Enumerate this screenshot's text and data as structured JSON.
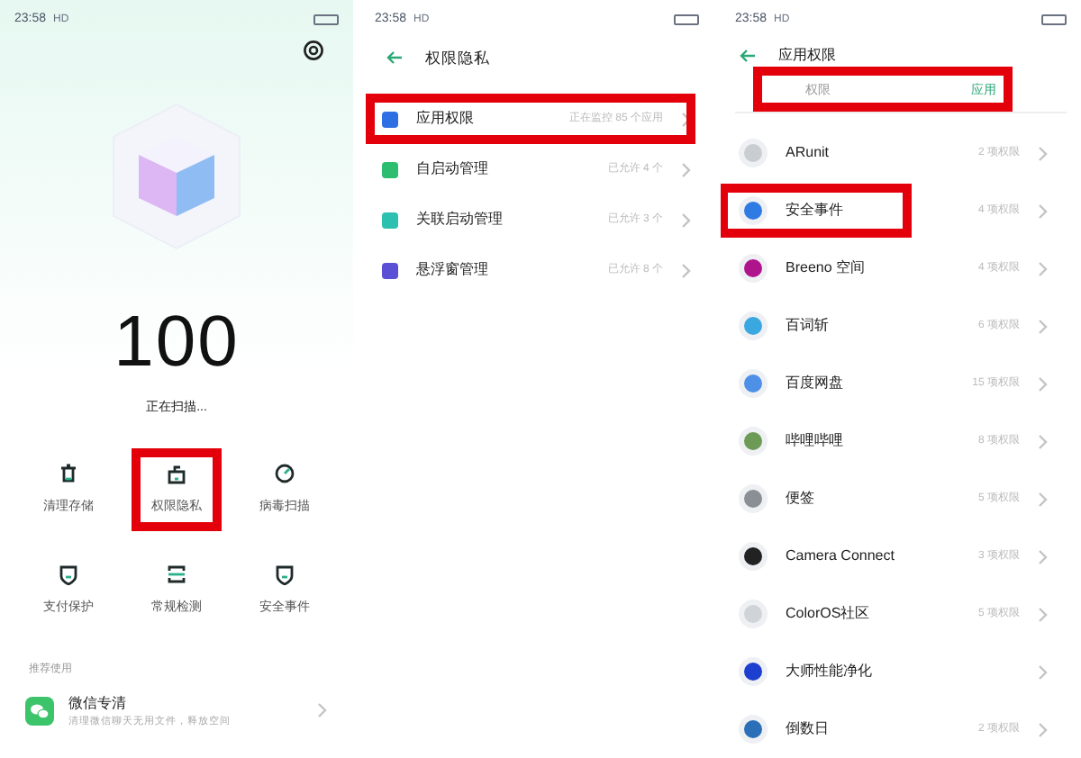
{
  "screens": [
    {
      "status_bar": {
        "time": "23:58",
        "network": "HD"
      },
      "score": "100",
      "scan_status": "正在扫描...",
      "tools": [
        {
          "label": "清理存储",
          "kind": "trash",
          "highlighted": false
        },
        {
          "label": "权限隐私",
          "kind": "lock",
          "highlighted": true
        },
        {
          "label": "病毒扫描",
          "kind": "gauge",
          "highlighted": false
        },
        {
          "label": "支付保护",
          "kind": "shield",
          "highlighted": false
        },
        {
          "label": "常规检测",
          "kind": "scan",
          "highlighted": false
        },
        {
          "label": "安全事件",
          "kind": "shield",
          "highlighted": false
        }
      ],
      "section_title": "推荐使用",
      "recommend": {
        "title": "微信专清",
        "subtitle": "清理微信聊天无用文件，释放空间"
      }
    },
    {
      "status_bar": {
        "time": "23:58",
        "network": "HD"
      },
      "title": "权限隐私",
      "rows": [
        {
          "label": "应用权限",
          "value": "正在监控 85 个应用",
          "color": "#2f6fe4",
          "highlighted": true
        },
        {
          "label": "自启动管理",
          "value": "已允许 4 个",
          "color": "#2dbd6e",
          "highlighted": false
        },
        {
          "label": "关联启动管理",
          "value": "已允许 3 个",
          "color": "#2cc0b0",
          "highlighted": false
        },
        {
          "label": "悬浮窗管理",
          "value": "已允许 8 个",
          "color": "#5b4fd6",
          "highlighted": false
        }
      ]
    },
    {
      "status_bar": {
        "time": "23:58",
        "network": "HD"
      },
      "title": "应用权限",
      "tabs_highlighted": true,
      "tabs": [
        {
          "label": "权限",
          "selected": false
        },
        {
          "label": "应用",
          "selected": true
        }
      ],
      "apps": [
        {
          "name": "ARunit",
          "value": "2 项权限",
          "color": "#c9ccd0",
          "highlighted": false
        },
        {
          "name": "安全事件",
          "value": "4 项权限",
          "color": "#2f7be4",
          "highlighted": true
        },
        {
          "name": "Breeno 空间",
          "value": "4 项权限",
          "color": "#b0148c",
          "highlighted": false
        },
        {
          "name": "百词斩",
          "value": "6 项权限",
          "color": "#3aa7e0",
          "highlighted": false
        },
        {
          "name": "百度网盘",
          "value": "15 项权限",
          "color": "#4e8fe8",
          "highlighted": false
        },
        {
          "name": "哔哩哔哩",
          "value": "8 项权限",
          "color": "#6d9a55",
          "highlighted": false
        },
        {
          "name": "便签",
          "value": "5 项权限",
          "color": "#8a8f96",
          "highlighted": false
        },
        {
          "name": "Camera Connect",
          "value": "3 项权限",
          "color": "#222222",
          "highlighted": false
        },
        {
          "name": "ColorOS社区",
          "value": "5 项权限",
          "color": "#d0d3d8",
          "highlighted": false
        },
        {
          "name": "大师性能净化",
          "color": "#1c3fcf",
          "highlighted": false
        },
        {
          "name": "倒数日",
          "value": "2 项权限",
          "color": "#2a6fb8",
          "highlighted": false
        }
      ]
    }
  ]
}
